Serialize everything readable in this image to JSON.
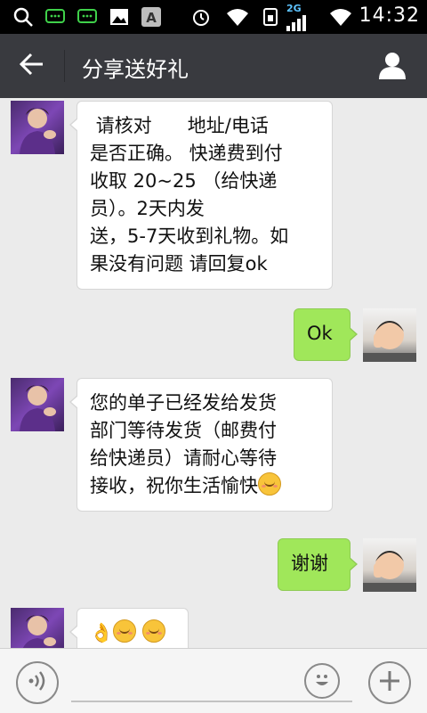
{
  "status_bar": {
    "time": "14:32",
    "network": "2G",
    "icons": [
      "search-icon",
      "chat-icon",
      "chat-icon",
      "image-icon",
      "font-icon",
      "alarm-icon",
      "wifi-icon",
      "sim-icon",
      "signal-icon",
      "wifi-icon",
      "battery-icon"
    ]
  },
  "header": {
    "title": "分享送好礼",
    "back_icon": "arrow-left-icon",
    "profile_icon": "person-icon"
  },
  "messages": [
    {
      "side": "left",
      "text": " 请核对      地址/电话\n是否正确。 快递费到付\n收取 20~25 （给快递\n员）。2天内发\n送，5-7天收到礼物。如\n果没有问题 请回复ok"
    },
    {
      "side": "right",
      "text": "Ok"
    },
    {
      "side": "left",
      "text": "您的单子已经发给发货\n部门等待发货（邮费付\n给快递员）请耐心等待\n接收，祝你生活愉快",
      "emoji": "smile-emoji"
    },
    {
      "side": "right",
      "text": "谢谢"
    },
    {
      "side": "left",
      "text": "👌",
      "emoji": "smile-emoji"
    }
  ],
  "input_bar": {
    "placeholder": "",
    "voice_icon": "voice-icon",
    "emoji_icon": "emoji-icon",
    "plus_icon": "plus-icon"
  },
  "colors": {
    "status_bar": "#000000",
    "title_bar": "#393a3f",
    "chat_background": "#ebebeb",
    "sent_bubble": "#a0e75a",
    "received_bubble": "#ffffff"
  }
}
